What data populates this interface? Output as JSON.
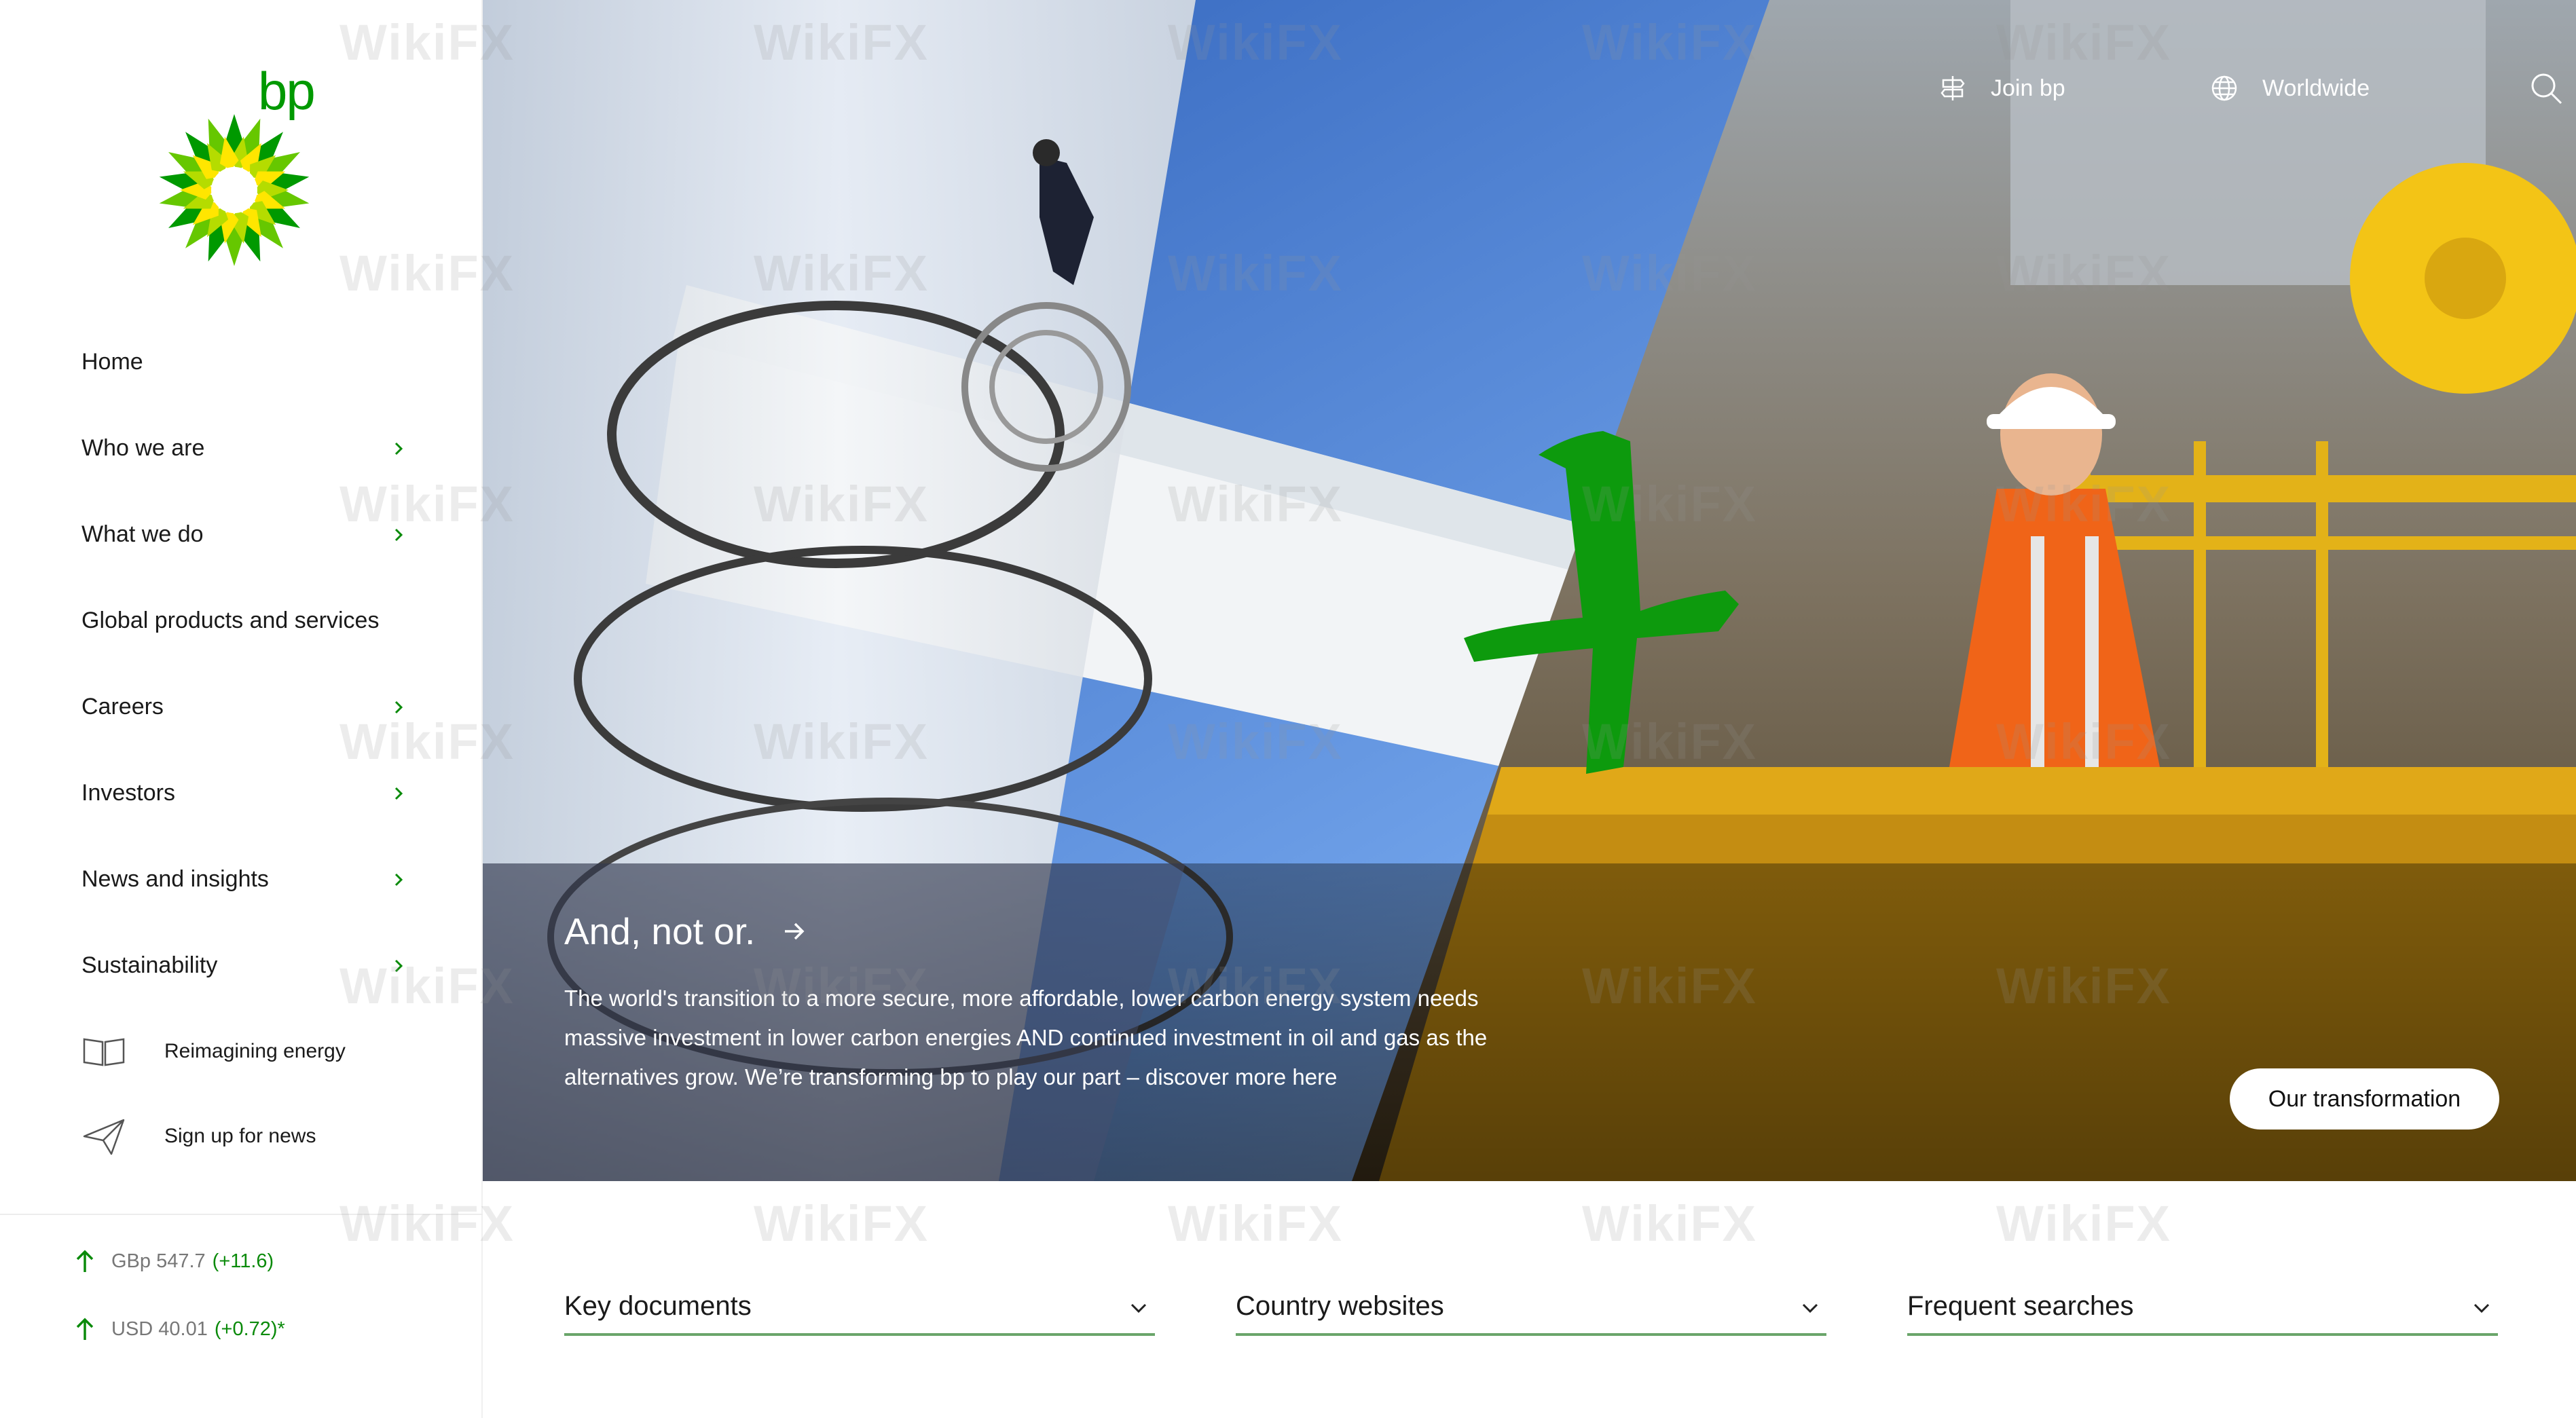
{
  "brand": {
    "wordmark": "bp",
    "green": "#009900",
    "yellow": "#ffe600"
  },
  "sidebar": {
    "nav": [
      {
        "label": "Home",
        "has_submenu": false
      },
      {
        "label": "Who we are",
        "has_submenu": true
      },
      {
        "label": "What we do",
        "has_submenu": true
      },
      {
        "label": "Global products and services",
        "has_submenu": false
      },
      {
        "label": "Careers",
        "has_submenu": true
      },
      {
        "label": "Investors",
        "has_submenu": true
      },
      {
        "label": "News and insights",
        "has_submenu": true
      },
      {
        "label": "Sustainability",
        "has_submenu": true
      }
    ],
    "secondary": [
      {
        "label": "Reimagining energy",
        "icon": "book-icon"
      },
      {
        "label": "Sign up for news",
        "icon": "paper-plane-icon"
      }
    ],
    "stocks": [
      {
        "value": "GBp 547.7",
        "change": "(+11.6)",
        "direction": "up"
      },
      {
        "value": "USD 40.01",
        "change": "(+0.72)*",
        "direction": "up"
      }
    ]
  },
  "header": {
    "join_label": "Join bp",
    "region_label": "Worldwide",
    "search_icon": "search-icon"
  },
  "hero": {
    "title": "And, not or.",
    "body": "The world's transition to a more secure, more affordable, lower carbon energy system needs massive investment in lower carbon energies AND continued investment in oil and gas as the alternatives grow. We’re transforming bp to play our part – discover more here",
    "cta_label": "Our transformation"
  },
  "dropdowns": [
    {
      "label": "Key documents"
    },
    {
      "label": "Country websites"
    },
    {
      "label": "Frequent searches"
    }
  ],
  "watermark_text": "WikiFX"
}
